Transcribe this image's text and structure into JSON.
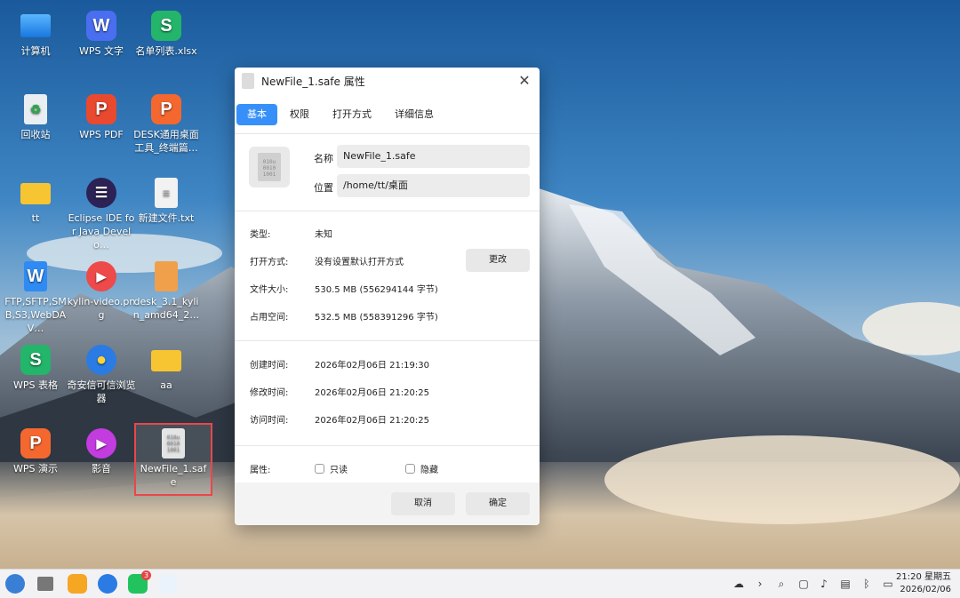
{
  "desktop": {
    "icons": [
      {
        "label": "计算机"
      },
      {
        "label": "WPS 文字"
      },
      {
        "label": "名单列表.xlsx"
      },
      {
        "label": "回收站"
      },
      {
        "label": "WPS PDF"
      },
      {
        "label": "DESK通用桌面工具_终端篇…"
      },
      {
        "label": "tt"
      },
      {
        "label": "Eclipse IDE for Java Develo…"
      },
      {
        "label": "新建文件.txt"
      },
      {
        "label": "FTP,SFTP,SMB,S3,WebDAV…"
      },
      {
        "label": "kylin-video.png"
      },
      {
        "label": "desk_3.1_kylin_amd64_2…"
      },
      {
        "label": "WPS 表格"
      },
      {
        "label": "奇安信可信浏览器"
      },
      {
        "label": "aa"
      },
      {
        "label": "WPS 演示"
      },
      {
        "label": "影音"
      },
      {
        "label": "NewFile_1.safe"
      }
    ]
  },
  "dialog": {
    "title": "NewFile_1.safe 属性",
    "tabs": [
      "基本",
      "权限",
      "打开方式",
      "详细信息"
    ],
    "name_label": "名称",
    "name_value": "NewFile_1.safe",
    "location_label": "位置",
    "location_value": "/home/tt/桌面",
    "type_label": "类型:",
    "type_value": "未知",
    "open_with_label": "打开方式:",
    "open_with_value": "没有设置默认打开方式",
    "change_button": "更改",
    "size_label": "文件大小:",
    "size_value": "530.5 MB (556294144 字节)",
    "disk_label": "占用空间:",
    "disk_value": "532.5 MB (558391296 字节)",
    "created_label": "创建时间:",
    "created_value": "2026年02月06日 21:19:30",
    "modified_label": "修改时间:",
    "modified_value": "2026年02月06日 21:20:25",
    "accessed_label": "访问时间:",
    "accessed_value": "2026年02月06日 21:20:25",
    "attr_label": "属性:",
    "readonly_label": "只读",
    "hidden_label": "隐藏",
    "cancel_button": "取消",
    "ok_button": "确定",
    "file_icon_text": "010u 0010 1001"
  },
  "taskbar": {
    "clock_time": "21:20 星期五",
    "clock_date": "2026/02/06",
    "badge_count": "3"
  },
  "colors": {
    "accent": "#3790fa",
    "selection": "#e8474c"
  }
}
